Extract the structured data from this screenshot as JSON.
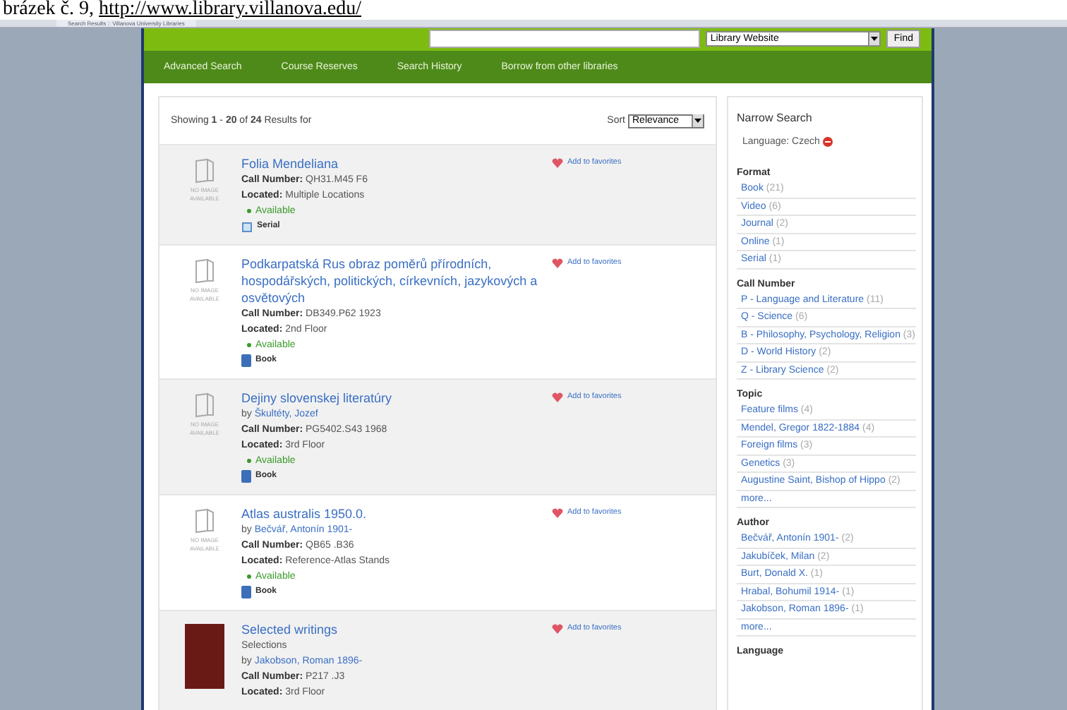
{
  "caption": {
    "label": "brázek č. 9, ",
    "link": "http://www.library.villanova.edu/"
  },
  "browser": {
    "tab_title": "Search Results :: Villanova University Libraries"
  },
  "header": {
    "search_scope": "Library Website",
    "find_button": "Find"
  },
  "nav": [
    "Advanced Search",
    "Course Reserves",
    "Search History",
    "Borrow from other libraries"
  ],
  "results": {
    "summary": "Showing **1** - **20** of **24** Results for",
    "sort_label": "Sort",
    "sort_value": "Relevance",
    "items": [
      {
        "cover": {
          "kind": "placeholder",
          "text": "NO IMAGE AVAILABLE"
        },
        "title": "Folia Mendeliana",
        "call_label": "Call Number:",
        "call_number": "QH31.M45 F6",
        "located_label": "Located:",
        "located": "Multiple Locations",
        "status": "Available",
        "format": {
          "kind": "serial",
          "label": "Serial"
        },
        "favorite": "Add to favorites"
      },
      {
        "cover": {
          "kind": "placeholder",
          "text": "NO IMAGE AVAILABLE"
        },
        "title": "Podkarpatská Rus obraz poměrů přírodních, hospodářských, politických, církevních, jazykových a osvětových",
        "call_label": "Call Number:",
        "call_number": "DB349.P62 1923",
        "located_label": "Located:",
        "located": "2nd Floor",
        "status": "Available",
        "format": {
          "kind": "book",
          "label": "Book"
        },
        "favorite": "Add to favorites"
      },
      {
        "cover": {
          "kind": "placeholder",
          "text": "NO IMAGE AVAILABLE"
        },
        "title": "Dejiny slovenskej literatúry",
        "by_label": "by",
        "author": "Škultéty, Jozef",
        "call_label": "Call Number:",
        "call_number": "PG5402.S43 1968",
        "located_label": "Located:",
        "located": "3rd Floor",
        "status": "Available",
        "format": {
          "kind": "book",
          "label": "Book"
        },
        "favorite": "Add to favorites"
      },
      {
        "cover": {
          "kind": "placeholder",
          "text": "NO IMAGE AVAILABLE"
        },
        "title": "Atlas australis 1950.0.",
        "by_label": "by",
        "author": "Bečvář, Antonín 1901-",
        "call_label": "Call Number:",
        "call_number": "QB65 .B36",
        "located_label": "Located:",
        "located": "Reference-Atlas Stands",
        "status": "Available",
        "format": {
          "kind": "book",
          "label": "Book"
        },
        "favorite": "Add to favorites"
      },
      {
        "cover": {
          "kind": "photo"
        },
        "title": "Selected writings",
        "subtitle": "Selections",
        "by_label": "by",
        "author": "Jakobson, Roman 1896-",
        "call_label": "Call Number:",
        "call_number": "P217 .J3",
        "located_label": "Located:",
        "located": "3rd Floor",
        "favorite": "Add to favorites"
      }
    ]
  },
  "narrow": {
    "title": "Narrow Search",
    "applied": "Language: Czech",
    "groups": [
      {
        "heading": "Format",
        "items": [
          {
            "label": "Book",
            "count": "(21)"
          },
          {
            "label": "Video",
            "count": "(6)"
          },
          {
            "label": "Journal",
            "count": "(2)"
          },
          {
            "label": "Online",
            "count": "(1)"
          },
          {
            "label": "Serial",
            "count": "(1)"
          }
        ]
      },
      {
        "heading": "Call Number",
        "items": [
          {
            "label": "P - Language and Literature",
            "count": "(11)"
          },
          {
            "label": "Q - Science",
            "count": "(6)"
          },
          {
            "label": "B - Philosophy, Psychology, Religion",
            "count": "(3)"
          },
          {
            "label": "D - World History",
            "count": "(2)"
          },
          {
            "label": "Z - Library Science",
            "count": "(2)"
          }
        ]
      },
      {
        "heading": "Topic",
        "items": [
          {
            "label": "Feature films",
            "count": "(4)"
          },
          {
            "label": "Mendel, Gregor 1822-1884",
            "count": "(4)"
          },
          {
            "label": "Foreign films",
            "count": "(3)"
          },
          {
            "label": "Genetics",
            "count": "(3)"
          },
          {
            "label": "Augustine Saint, Bishop of Hippo",
            "count": "(2)"
          }
        ],
        "more": "more..."
      },
      {
        "heading": "Author",
        "items": [
          {
            "label": "Bečvář, Antonín 1901-",
            "count": "(2)"
          },
          {
            "label": "Jakubíček, Milan",
            "count": "(2)"
          },
          {
            "label": "Burt, Donald X.",
            "count": "(1)"
          },
          {
            "label": "Hrabal, Bohumil 1914-",
            "count": "(1)"
          },
          {
            "label": "Jakobson, Roman 1896-",
            "count": "(1)"
          }
        ],
        "more": "more..."
      },
      {
        "heading": "Language"
      }
    ]
  }
}
